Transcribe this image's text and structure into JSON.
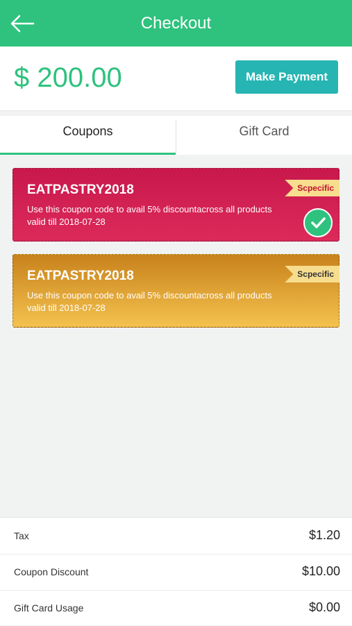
{
  "header": {
    "title": "Checkout",
    "back_icon": "arrow-left-icon"
  },
  "amount": {
    "value": "$ 200.00"
  },
  "actions": {
    "make_payment": "Make Payment"
  },
  "tabs": [
    {
      "label": "Coupons",
      "active": true
    },
    {
      "label": "Gift Card",
      "active": false
    }
  ],
  "coupons": [
    {
      "code": "EATPASTRY2018",
      "description": "Use this coupon code to avail 5% discountacross all products valid till 2018-07-28",
      "tag": "Scpecific",
      "selected": true,
      "color": "#c8184c"
    },
    {
      "code": "EATPASTRY2018",
      "description": "Use this coupon code to avail 5% discountacross all products valid till 2018-07-28",
      "tag": "Scpecific",
      "selected": false,
      "color": "#e0a83a"
    }
  ],
  "summary": [
    {
      "label": "Tax",
      "value": "$1.20"
    },
    {
      "label": "Coupon Discount",
      "value": "$10.00"
    },
    {
      "label": "Gift Card Usage",
      "value": "$0.00"
    }
  ],
  "colors": {
    "primary": "#2ec27e",
    "button": "#26b5b2"
  }
}
